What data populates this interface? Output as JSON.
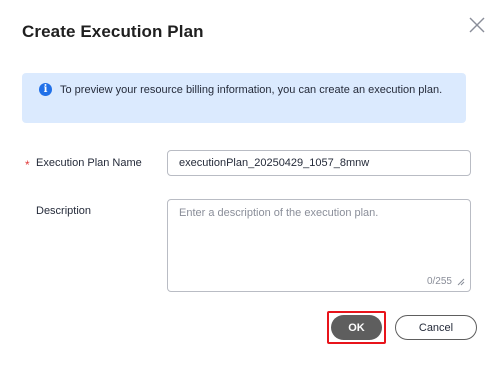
{
  "dialog": {
    "title": "Create Execution Plan",
    "close_icon": "close-icon"
  },
  "info_banner": {
    "icon": "info-icon",
    "icon_glyph": "i",
    "text": "To preview your resource billing information, you can create an execution plan.",
    "accent_color": "#2070e8",
    "background_color": "#dbeafe"
  },
  "form": {
    "name": {
      "required_marker": "*",
      "label": "Execution Plan Name",
      "value": "executionPlan_20250429_1057_8mnw"
    },
    "description": {
      "label": "Description",
      "placeholder": "Enter a description of the execution plan.",
      "value": "",
      "char_count": "0/255"
    }
  },
  "footer": {
    "ok_label": "OK",
    "cancel_label": "Cancel",
    "highlight_color": "#e8141b"
  }
}
